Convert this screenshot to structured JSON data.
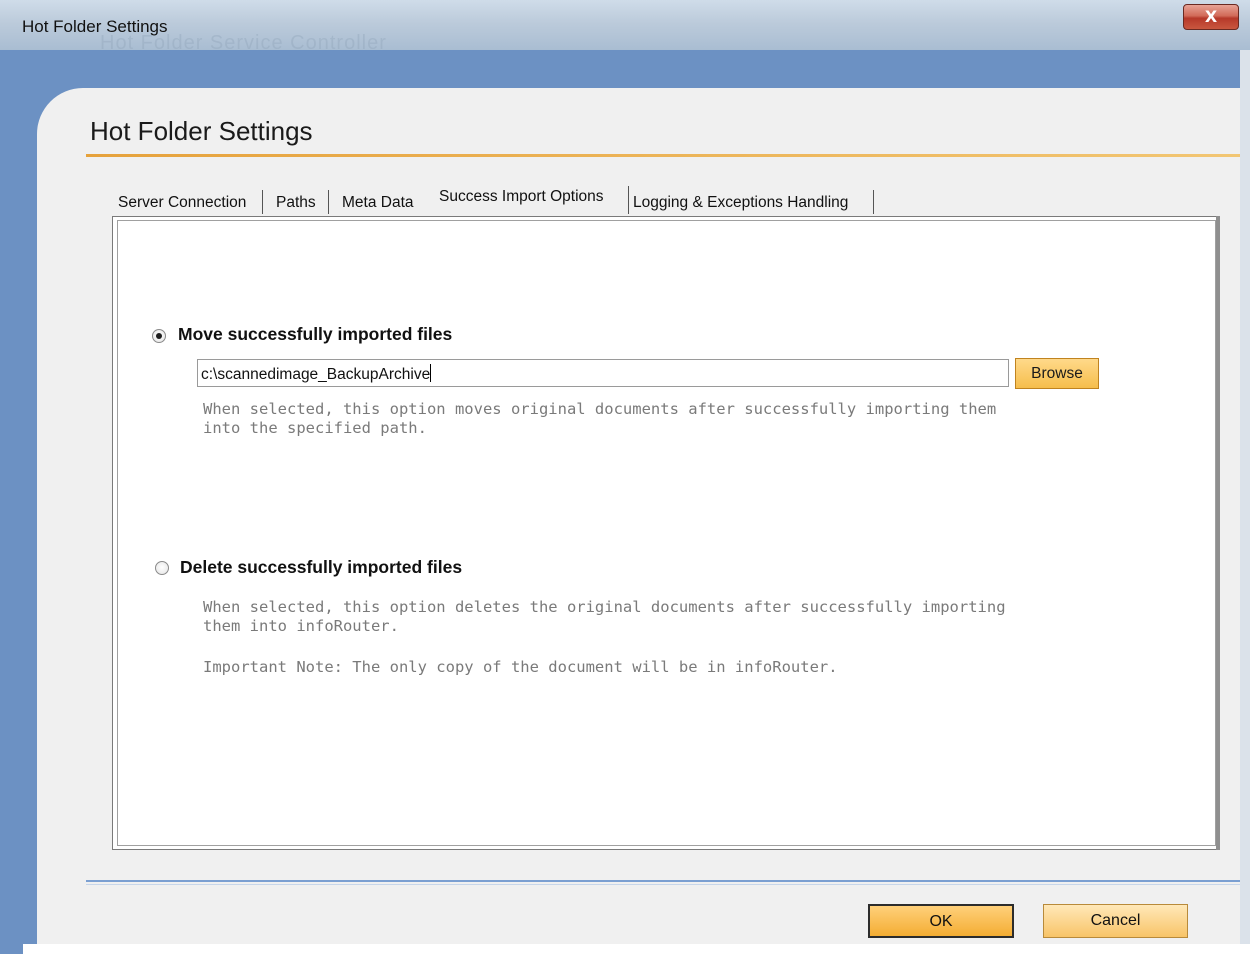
{
  "window": {
    "title": "Hot Folder Settings",
    "background_title": "Hot Folder Service Controller",
    "close_glyph": "X"
  },
  "dialog": {
    "heading": "Hot Folder Settings"
  },
  "tabs": [
    {
      "label": "Server Connection",
      "active": false
    },
    {
      "label": "Paths",
      "active": false
    },
    {
      "label": "Meta Data",
      "active": false
    },
    {
      "label": "Success Import Options",
      "active": true
    },
    {
      "label": "Logging & Exceptions Handling",
      "active": false
    }
  ],
  "options": {
    "move": {
      "label": "Move successfully imported files",
      "selected": true,
      "path_value": "c:\\scannedimage_BackupArchive",
      "browse_label": "Browse",
      "description_line1": "When selected, this option moves original documents after successfully importing them",
      "description_line2": "into the specified path."
    },
    "delete": {
      "label": "Delete successfully imported files",
      "selected": false,
      "description_line1": "When selected, this option deletes the original documents after successfully importing",
      "description_line2": "them into infoRouter.",
      "note": "Important Note: The only copy of the document will be in infoRouter."
    }
  },
  "buttons": {
    "ok": "OK",
    "cancel": "Cancel"
  },
  "colors": {
    "accent_orange": "#f4ad33",
    "frame_blue": "#6c91c3",
    "close_red": "#c9573f"
  }
}
